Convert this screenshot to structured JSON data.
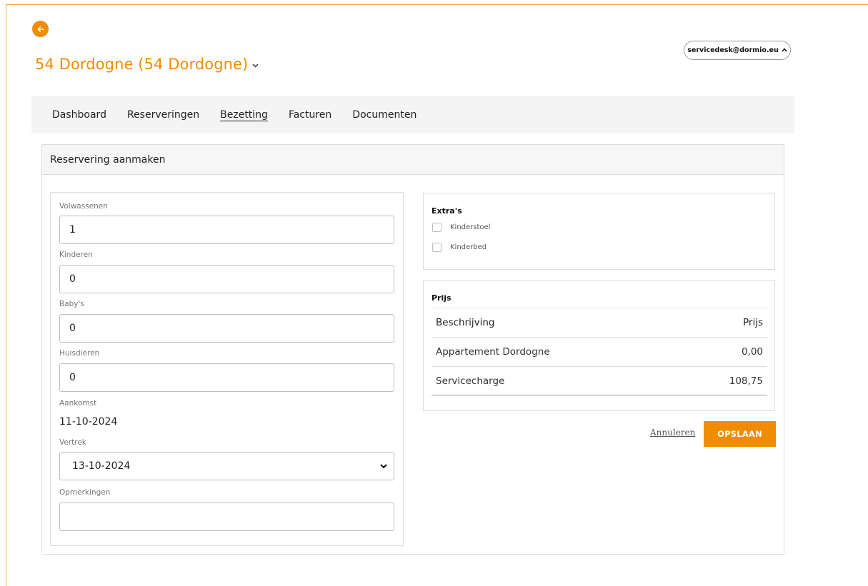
{
  "colors": {
    "accent": "#f08c00",
    "frame": "#f0a93a",
    "nav_bg": "#f4f4f4",
    "border": "#dcdcdc"
  },
  "header": {
    "back_icon": "arrow-left-icon",
    "title": "54 Dordogne (54 Dordogne)",
    "title_chevron_icon": "chevron-down-icon",
    "user_email": "servicedesk@dormio.eu",
    "user_caret_icon": "chevron-up-icon"
  },
  "nav": {
    "items": [
      {
        "label": "Dashboard",
        "active": false
      },
      {
        "label": "Reserveringen",
        "active": false
      },
      {
        "label": "Bezetting",
        "active": true
      },
      {
        "label": "Facturen",
        "active": false
      },
      {
        "label": "Documenten",
        "active": false
      }
    ]
  },
  "card": {
    "title": "Reservering aanmaken"
  },
  "form": {
    "adults_label": "Volwassenen",
    "adults_value": "1",
    "children_label": "Kinderen",
    "children_value": "0",
    "babies_label": "Baby's",
    "babies_value": "0",
    "pets_label": "Huisdieren",
    "pets_value": "0",
    "arrival_label": "Aankomst",
    "arrival_value": "11-10-2024",
    "departure_label": "Vertrek",
    "departure_value": "13-10-2024",
    "remarks_label": "Opmerkingen",
    "remarks_value": ""
  },
  "extras": {
    "title": "Extra's",
    "options": [
      {
        "label": "Kinderstoel",
        "checked": false
      },
      {
        "label": "Kinderbed",
        "checked": false
      }
    ]
  },
  "price": {
    "title": "Prijs",
    "header": {
      "description": "Beschrijving",
      "price": "Prijs"
    },
    "rows": [
      {
        "description": "Appartement Dordogne",
        "price": "0,00"
      },
      {
        "description": "Servicecharge",
        "price": "108,75"
      }
    ]
  },
  "actions": {
    "cancel_label": "Annuleren",
    "save_label": "OPSLAAN"
  }
}
